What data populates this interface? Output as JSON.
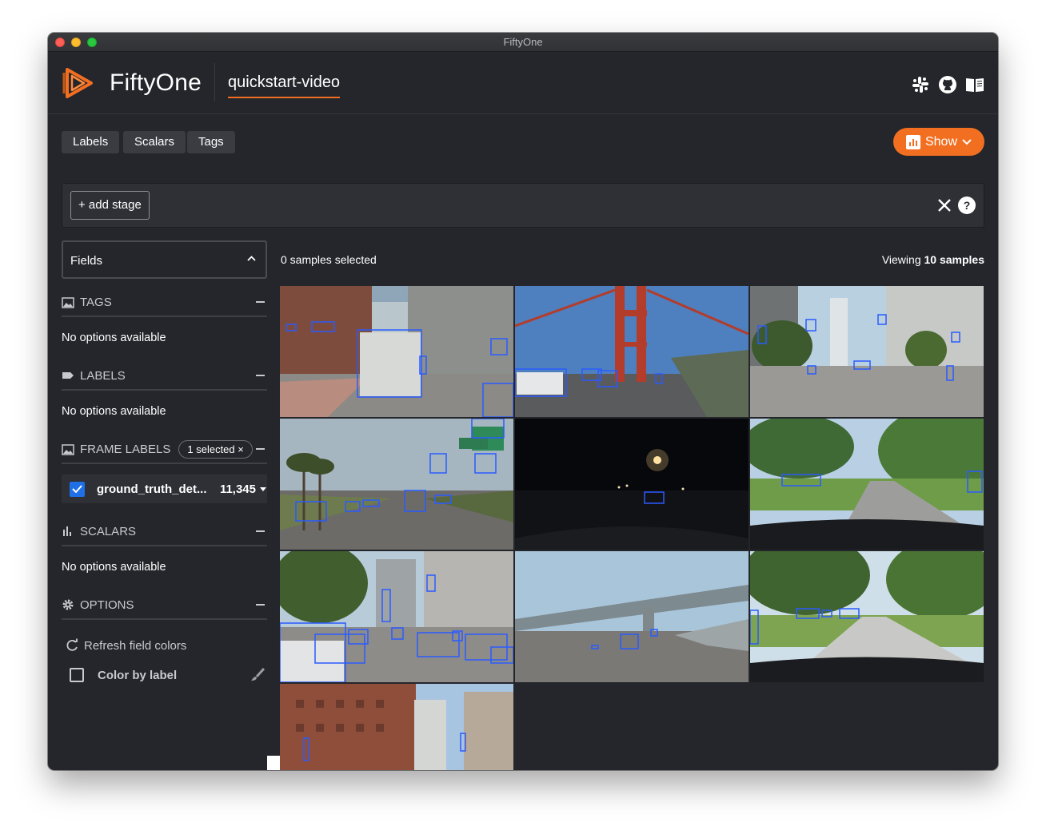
{
  "window": {
    "title": "FiftyOne"
  },
  "header": {
    "brand": "FiftyOne",
    "dataset": "quickstart-video",
    "icons": [
      "slack-icon",
      "github-icon",
      "docs-book-icon"
    ]
  },
  "tabs": [
    "Labels",
    "Scalars",
    "Tags"
  ],
  "show_button": {
    "label": "Show",
    "icon": "bar-chart-icon"
  },
  "stage": {
    "add_label": "+ add stage"
  },
  "sidebar": {
    "fields_label": "Fields",
    "tags": {
      "title": "TAGS",
      "empty": "No options available"
    },
    "labels": {
      "title": "LABELS",
      "empty": "No options available"
    },
    "frame_labels": {
      "title": "FRAME LABELS",
      "badge": "1 selected",
      "field": "ground_truth_det...",
      "count": "11,345"
    },
    "scalars": {
      "title": "SCALARS",
      "empty": "No options available"
    },
    "options": {
      "title": "OPTIONS",
      "refresh": "Refresh field colors",
      "color_by_label": "Color by label"
    }
  },
  "main": {
    "selected_text": "0 samples selected",
    "viewing_prefix": "Viewing ",
    "viewing_count": "10 samples"
  },
  "colors": {
    "accent": "#f26f21",
    "box": "#2a5bff",
    "checkbox": "#1f6fe6"
  },
  "samples": [
    {
      "scene": "city-street-truck"
    },
    {
      "scene": "golden-gate-bridge"
    },
    {
      "scene": "downtown-intersection"
    },
    {
      "scene": "palm-road"
    },
    {
      "scene": "night-road"
    },
    {
      "scene": "suburban-road"
    },
    {
      "scene": "busy-downtown"
    },
    {
      "scene": "overpass-highway"
    },
    {
      "scene": "tree-lined-street"
    },
    {
      "scene": "brick-buildings-street"
    }
  ]
}
